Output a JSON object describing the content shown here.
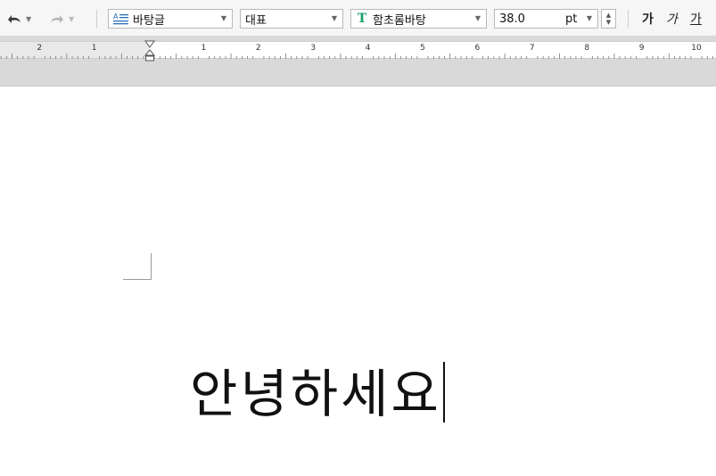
{
  "toolbar": {
    "style_name": "바탕글",
    "outline_level": "대표",
    "font_name": "함초롬바탕",
    "font_size": "38.0",
    "size_unit": "pt",
    "bold_glyph": "가",
    "italic_glyph": "가",
    "underline_glyph": "가"
  },
  "ruler": {
    "labels": [
      "2",
      "1",
      "1",
      "2",
      "3",
      "4",
      "5",
      "6",
      "7",
      "8",
      "9",
      "10"
    ]
  },
  "document": {
    "text": "안녕하세요"
  },
  "colors": {
    "font_icon": "#18a06b",
    "ruler_margin": "#e9e9e9",
    "toolbar_bg": "#f6f6f6"
  }
}
